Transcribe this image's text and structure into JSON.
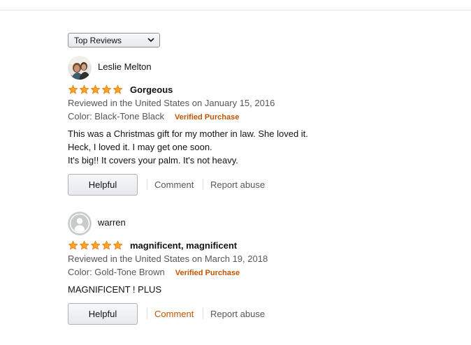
{
  "sort": {
    "selected": "Top Reviews"
  },
  "colors": {
    "star": "#ffa41c",
    "verified": "#c45500",
    "link_accent": "#c45500",
    "meta_text": "#565959"
  },
  "reviews": [
    {
      "reviewer": "Leslie Melton",
      "avatar": "photo",
      "stars": 5,
      "title": "Gorgeous",
      "reviewed_in": "Reviewed in the United States on January 15, 2016",
      "variant": "Color: Black-Tone Black",
      "verified": "Verified Purchase",
      "body": [
        "This was a Christmas gift for my mother in law. She loved it.",
        "Heck, I loved it. I may get one soon.",
        "It's big!! It covers your palm. It's not heavy."
      ],
      "helpful": "Helpful",
      "comment": "Comment",
      "report": "Report abuse"
    },
    {
      "reviewer": "warren",
      "avatar": "default",
      "stars": 5,
      "title": "magnificent, magnificent",
      "reviewed_in": "Reviewed in the United States on March 19, 2018",
      "variant": "Color: Gold-Tone Brown",
      "verified": "Verified Purchase",
      "body": [
        "MAGNIFICENT ! PLUS"
      ],
      "helpful": "Helpful",
      "comment": "Comment",
      "report": "Report abuse"
    }
  ]
}
